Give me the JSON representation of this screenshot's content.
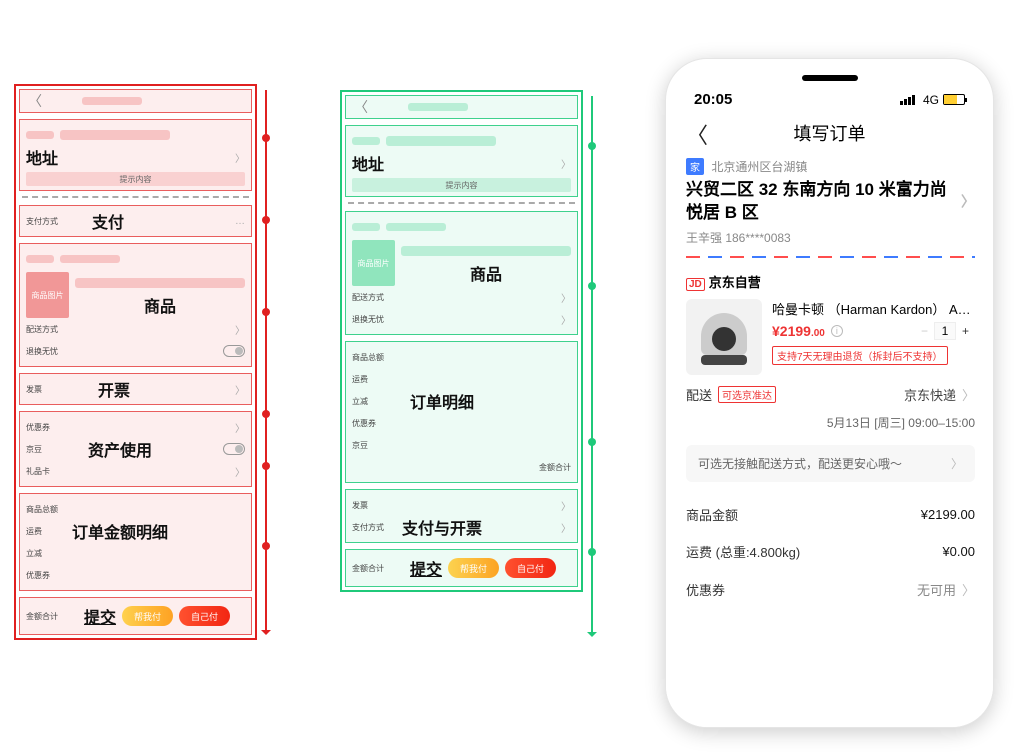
{
  "wireframeA": {
    "address_label": "地址",
    "address_hint": "提示内容",
    "pay_row_label": "支付方式",
    "pay_label": "支付",
    "goods_label": "商品",
    "goods_img_label": "商品图片",
    "delivery_label": "配送方式",
    "return_label": "退换无忧",
    "invoice_row_label": "发票",
    "invoice_label": "开票",
    "coupon_label": "优惠券",
    "jdbean_label": "京豆",
    "giftcard_label": "礼品卡",
    "asset_label": "资产使用",
    "subtotal_label": "商品总额",
    "ship_label": "运费",
    "discount_label": "立减",
    "coupon2_label": "优惠券",
    "amount_label": "订单金额明细",
    "total_label": "金额合计",
    "submit_label": "提交",
    "help_pay": "帮我付",
    "self_pay": "自己付"
  },
  "wireframeB": {
    "address_label": "地址",
    "address_hint": "提示内容",
    "goods_label": "商品",
    "goods_img_label": "商品图片",
    "delivery_label": "配送方式",
    "return_label": "退换无忧",
    "subtotal_label": "商品总额",
    "ship_label": "运费",
    "discount_label": "立减",
    "coupon_label": "优惠券",
    "jdbean_label": "京豆",
    "detail_label": "订单明细",
    "total_small_label": "金额合计",
    "invoice_label": "发票",
    "paymethod_label": "支付方式",
    "payinvoice_label": "支付与开票",
    "total_label": "金额合计",
    "submit_label": "提交",
    "help_pay": "帮我付",
    "self_pay": "自己付"
  },
  "phone": {
    "time": "20:05",
    "net": "4G",
    "nav_title": "填写订单",
    "addr_tag": "家",
    "addr_city": "北京通州区台湖镇",
    "addr_line": "兴贸二区 32 东南方向 10 米富力尚悦居 B 区",
    "addr_person": "王辛强  186****0083",
    "seller_badge": "JD",
    "seller_name": "京东自营",
    "product_title": "哈曼卡顿 （Harman Kardon） Aura St...",
    "price_main": "2199",
    "price_dec": ".00",
    "qty": "1",
    "return_badge": "支持7天无理由退货（拆封后不支持）",
    "ship_k": "配送",
    "ship_chip": "可选京准达",
    "ship_v": "京东快递",
    "ship_sub_date": "5月13日",
    "ship_sub_day": "[周三]",
    "ship_sub_time": "09:00–15:00",
    "notice": "可选无接触配送方式，配送更安心哦～",
    "amount_k": "商品金额",
    "amount_v": "¥2199.00",
    "fee_k": "运费 (总重:4.800kg)",
    "fee_v": "¥0.00",
    "coupon_k": "优惠券",
    "coupon_v": "无可用"
  }
}
